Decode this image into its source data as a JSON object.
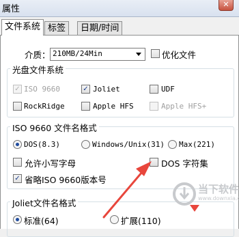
{
  "window": {
    "title": "属性",
    "close_glyph": "✕"
  },
  "tabs": [
    {
      "label": "文件系统",
      "active": true
    },
    {
      "label": "标签",
      "active": false
    },
    {
      "label": "日期/时间",
      "active": false
    }
  ],
  "media": {
    "label": "介质：",
    "selected": "210MB/24Min"
  },
  "optimize": {
    "label": "优化文件",
    "checked": false
  },
  "disc_fs": {
    "title": "光盘文件系统",
    "items": [
      {
        "label": "ISO 9660",
        "checked": true,
        "disabled": true
      },
      {
        "label": "Joliet",
        "checked": true,
        "disabled": false
      },
      {
        "label": "UDF",
        "checked": false,
        "disabled": false
      },
      {
        "label": "RockRidge",
        "checked": false,
        "disabled": false
      },
      {
        "label": "Apple HFS",
        "checked": false,
        "disabled": false
      },
      {
        "label": "Apple HFS+",
        "checked": false,
        "disabled": true
      }
    ]
  },
  "iso_format": {
    "title": "ISO 9660 文件名格式",
    "radios": [
      {
        "label": "DOS(8.3)",
        "selected": true
      },
      {
        "label": "Windows/Unix(31)",
        "selected": false
      },
      {
        "label": "Max(221)",
        "selected": false
      }
    ],
    "checks": [
      {
        "label": "允许小写字母",
        "checked": false
      },
      {
        "label": "DOS 字符集",
        "checked": false
      },
      {
        "label": "省略ISO 9660版本号",
        "checked": true
      }
    ]
  },
  "joliet_format": {
    "title": "Joliet文件名格式",
    "radios": [
      {
        "label": "标准(64)",
        "selected": true
      },
      {
        "label": "扩展(110)",
        "selected": false
      }
    ]
  },
  "watermark": {
    "line1": "当下软件园",
    "line2": "www.downxia.com"
  },
  "colors": {
    "annotation_arrow": "#e8463c",
    "checkmark": "#1a3c8a"
  }
}
